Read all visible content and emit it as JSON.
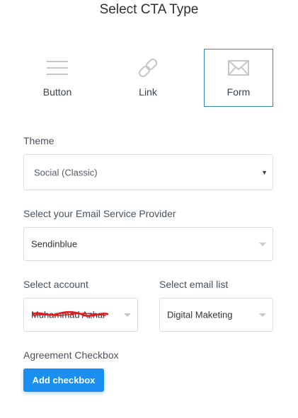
{
  "page": {
    "title": "Select CTA Type"
  },
  "cta_types": [
    {
      "label": "Button",
      "icon": "hamburger-lines-icon",
      "selected": false
    },
    {
      "label": "Link",
      "icon": "chain-link-icon",
      "selected": false
    },
    {
      "label": "Form",
      "icon": "envelope-icon",
      "selected": true
    }
  ],
  "theme": {
    "label": "Theme",
    "value": "Social (Classic)"
  },
  "email_provider": {
    "label": "Select your Email Service Provider",
    "value": "Sendinblue"
  },
  "account": {
    "label": "Select account",
    "value": "Muhammad Azhar",
    "redacted": true
  },
  "email_list": {
    "label": "Select email list",
    "value": "Digital Maketing"
  },
  "agreement": {
    "label": "Agreement Checkbox",
    "button_label": "Add checkbox"
  },
  "colors": {
    "selected_border": "#2e8bb9",
    "button_bg": "#1a8ff0",
    "icon_stroke": "#c2c7cc",
    "redaction_red": "#e01b1b"
  }
}
